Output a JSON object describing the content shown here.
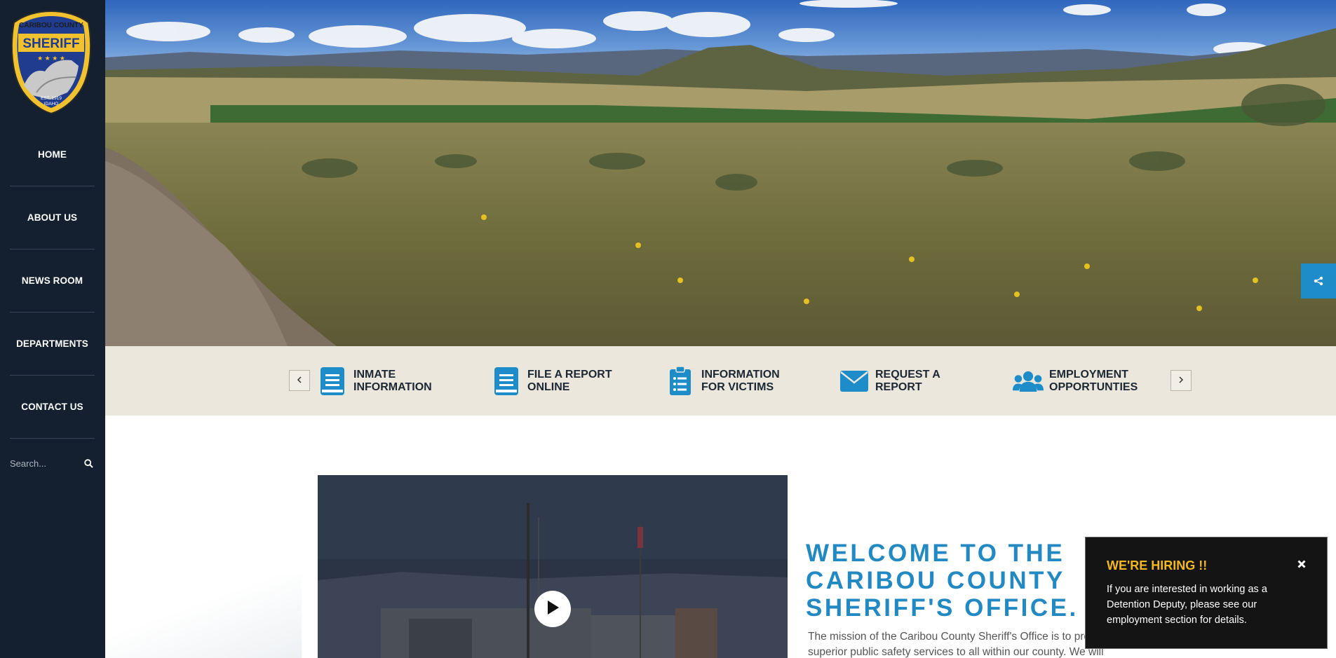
{
  "logo": {
    "top_text": "CARIBOU COUNTY",
    "main_text": "SHERIFF",
    "est_text": "EST. 1919",
    "state_text": "IDAHO"
  },
  "nav": {
    "items": [
      {
        "label": "HOME"
      },
      {
        "label": "ABOUT US"
      },
      {
        "label": "NEWS ROOM"
      },
      {
        "label": "DEPARTMENTS"
      },
      {
        "label": "CONTACT US"
      }
    ]
  },
  "search": {
    "placeholder": "Search...",
    "icon": "search-icon"
  },
  "hero": {
    "share_icon": "share-icon"
  },
  "quick_links": [
    {
      "line1": "INMATE",
      "line2": "INFORMATION",
      "icon": "document-icon"
    },
    {
      "line1": "FILE A REPORT",
      "line2": "ONLINE",
      "icon": "document-icon"
    },
    {
      "line1": "INFORMATION",
      "line2": "FOR VICTIMS",
      "icon": "clipboard-list-icon"
    },
    {
      "line1": "REQUEST A",
      "line2": "REPORT",
      "icon": "envelope-icon"
    },
    {
      "line1": "EMPLOYMENT",
      "line2": "OPPORTUNTIES",
      "icon": "users-icon"
    }
  ],
  "welcome": {
    "line1": "WELCOME TO THE",
    "line2": "CARIBOU COUNTY",
    "line3": "SHERIFF'S OFFICE.",
    "mission_line1": "The mission of the Caribou County Sheriff's Office is to provide",
    "mission_line2": "superior public safety services to all within our county.  We will"
  },
  "popup": {
    "title": "WE'RE HIRING !!",
    "body": "If you are interested in working as a Detention Deputy,  please see our employment section for details."
  },
  "colors": {
    "sidebar": "#14202f",
    "accent": "#2389c3",
    "band": "#ebe7dc",
    "popup_title": "#f3b720"
  }
}
